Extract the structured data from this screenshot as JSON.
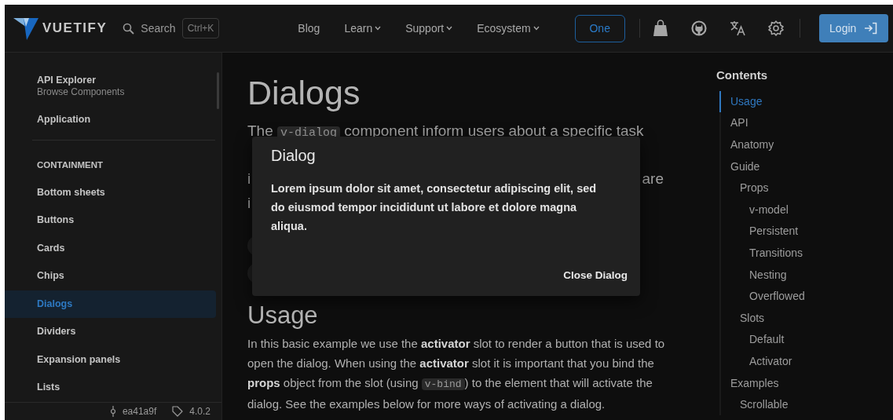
{
  "header": {
    "logo": "VUETIFY",
    "search": {
      "placeholder": "Search"
    },
    "shortcut": "Ctrl+K",
    "nav": [
      {
        "label": "Blog",
        "dropdown": false
      },
      {
        "label": "Learn",
        "dropdown": true
      },
      {
        "label": "Support",
        "dropdown": true
      },
      {
        "label": "Ecosystem",
        "dropdown": true
      }
    ],
    "one_button": "One",
    "login_button": "Login"
  },
  "sidebar": {
    "items": [
      {
        "kind": "link",
        "title": "API Explorer",
        "subtitle": "Browse Components",
        "selected": false
      },
      {
        "kind": "link",
        "title": "Application",
        "selected": false
      },
      {
        "kind": "divider"
      },
      {
        "kind": "header",
        "title": "CONTAINMENT"
      },
      {
        "kind": "link",
        "title": "Bottom sheets",
        "selected": false
      },
      {
        "kind": "link",
        "title": "Buttons",
        "selected": false
      },
      {
        "kind": "link",
        "title": "Cards",
        "selected": false
      },
      {
        "kind": "link",
        "title": "Chips",
        "selected": false
      },
      {
        "kind": "link",
        "title": "Dialogs",
        "selected": true
      },
      {
        "kind": "link",
        "title": "Dividers",
        "selected": false
      },
      {
        "kind": "link",
        "title": "Expansion panels",
        "selected": false
      },
      {
        "kind": "link",
        "title": "Lists",
        "selected": false
      }
    ],
    "commit": "ea41a9f",
    "version": "4.0.2"
  },
  "page": {
    "title": "Dialogs",
    "intro_lines": [
      [
        {
          "kind": "text",
          "text": "The"
        },
        {
          "kind": "code",
          "text": "v-dialog"
        },
        {
          "kind": "text",
          "text": "component inform users about a specific task"
        }
      ],
      [
        {
          "kind": "gap"
        }
      ],
      [
        {
          "kind": "text",
          "text": "i"
        },
        {
          "kind": "text",
          "text": "are"
        }
      ],
      [
        {
          "kind": "text",
          "text": "i"
        }
      ]
    ],
    "section": {
      "heading": "Usage",
      "paragraph": [
        {
          "kind": "text",
          "text": "In this basic example we use the **activator** slot to render a button that is used to open the dialog. When using the **activator** slot it is important that you bind the **props** object from the slot (using "
        },
        {
          "kind": "code",
          "text": "v-bind"
        },
        {
          "kind": "text",
          "text": ") to the element that will activate the dialog. See the examples below for more ways of activating a dialog."
        }
      ]
    }
  },
  "dialog": {
    "title": "Dialog",
    "body": "Lorem ipsum dolor sit amet, consectetur adipiscing elit, sed do eiusmod tempor incididunt ut labore et dolore magna aliqua.",
    "action": "Close Dialog"
  },
  "toc": {
    "title": "Contents",
    "items": [
      {
        "label": "Usage",
        "selected": true
      },
      {
        "label": "API",
        "selected": false
      },
      {
        "label": "Anatomy",
        "selected": false
      },
      {
        "label": "Guide",
        "selected": false,
        "children": [
          {
            "label": "Props",
            "selected": false,
            "children": [
              {
                "label": "v-model",
                "selected": false
              },
              {
                "label": "Persistent",
                "selected": false
              },
              {
                "label": "Transitions",
                "selected": false
              },
              {
                "label": "Nesting",
                "selected": false
              },
              {
                "label": "Overflowed",
                "selected": false
              }
            ]
          },
          {
            "label": "Slots",
            "selected": false,
            "children": [
              {
                "label": "Default",
                "selected": false
              },
              {
                "label": "Activator",
                "selected": false
              }
            ]
          }
        ]
      },
      {
        "label": "Examples",
        "selected": false,
        "children": [
          {
            "label": "Scrollable",
            "selected": false
          }
        ]
      }
    ]
  }
}
